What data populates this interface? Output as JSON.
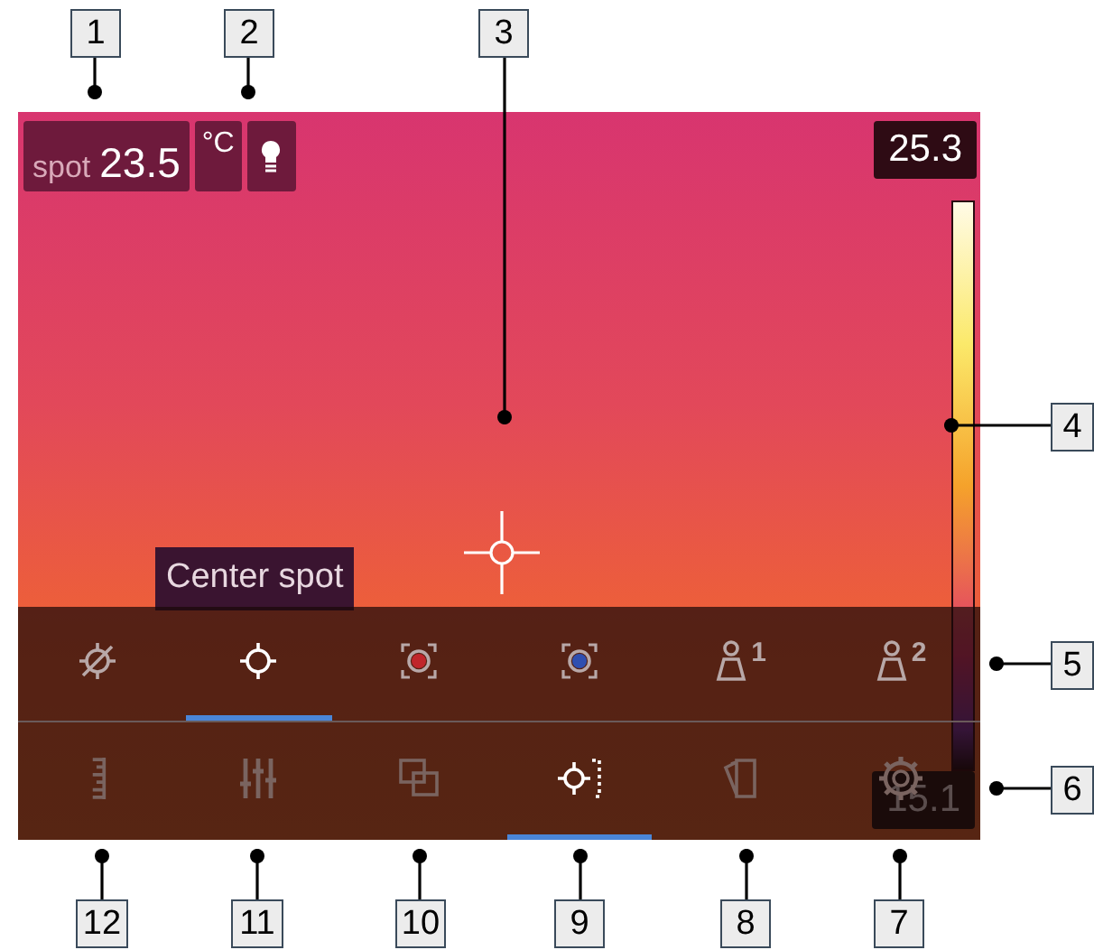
{
  "screen": {
    "spot": {
      "label": "spot",
      "value": "23.5"
    },
    "unit": "°C",
    "scale": {
      "max": "25.3",
      "min": "15.1"
    },
    "tooltip": "Center spot",
    "measurement_tools": [
      {
        "kind": "none",
        "selected": false
      },
      {
        "kind": "center",
        "selected": true
      },
      {
        "kind": "hot",
        "selected": false
      },
      {
        "kind": "cold",
        "selected": false
      },
      {
        "kind": "user",
        "label": "1",
        "selected": false
      },
      {
        "kind": "user",
        "label": "2",
        "selected": false
      }
    ],
    "main_menu": [
      {
        "kind": "ruler",
        "selected": false
      },
      {
        "kind": "sliders",
        "selected": false
      },
      {
        "kind": "overlay",
        "selected": false
      },
      {
        "kind": "measure",
        "selected": true
      },
      {
        "kind": "palette",
        "selected": false
      },
      {
        "kind": "settings",
        "selected": false
      }
    ]
  },
  "callouts": [
    "1",
    "2",
    "3",
    "4",
    "5",
    "6",
    "12",
    "11",
    "10",
    "9",
    "8",
    "7"
  ]
}
